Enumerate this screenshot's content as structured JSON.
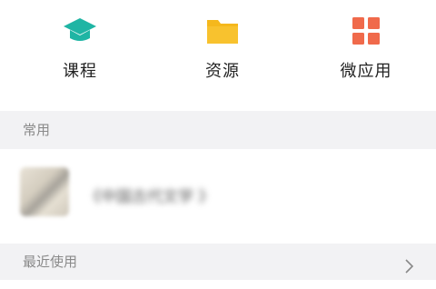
{
  "quick_access": [
    {
      "label": "课程",
      "icon": "graduation-cap-icon",
      "color": "#1fb5a4"
    },
    {
      "label": "资源",
      "icon": "folder-icon",
      "color": "#f5b81c"
    },
    {
      "label": "微应用",
      "icon": "app-grid-icon",
      "color": "#f06a4b"
    }
  ],
  "sections": {
    "common": {
      "title": "常用",
      "items": [
        {
          "title": "《中国古代文学 》"
        }
      ]
    },
    "recent": {
      "title": "最近使用",
      "icon": "chevron-right-icon"
    }
  }
}
